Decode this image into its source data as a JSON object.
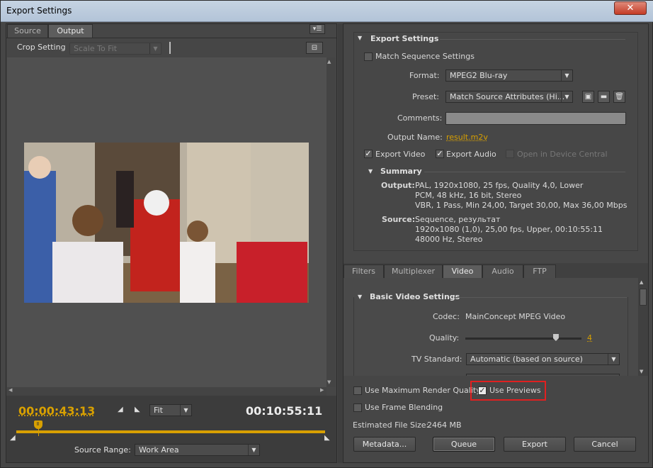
{
  "window": {
    "title": "Export Settings",
    "close_label": "✕"
  },
  "left": {
    "tabs": [
      {
        "label": "Source"
      },
      {
        "label": "Output"
      }
    ],
    "panel_menu_icon": "panel-menu-icon",
    "crop_label": "Crop Setting",
    "crop_value": "Scale To Fit",
    "timecode_current": "00:00:43:13",
    "timecode_total": "00:10:55:11",
    "zoom_value": "Fit",
    "source_range_label": "Source Range:",
    "source_range_value": "Work Area",
    "playhead_fraction": 0.07
  },
  "export": {
    "header": "Export Settings",
    "match_sequence": "Match Sequence Settings",
    "format_label": "Format:",
    "format_value": "MPEG2 Blu-ray",
    "preset_label": "Preset:",
    "preset_value": "Match Source Attributes (Hi...",
    "comments_label": "Comments:",
    "comments_value": "",
    "output_name_label": "Output Name:",
    "output_name_value": "result.m2v",
    "export_video": "Export Video",
    "export_audio": "Export Audio",
    "open_device_central": "Open in Device Central",
    "summary_header": "Summary",
    "output_label": "Output:",
    "output_lines": [
      "PAL, 1920x1080, 25 fps, Quality 4,0, Lower",
      "PCM, 48 kHz, 16 bit, Stereo",
      "VBR, 1 Pass, Min 24,00, Target 30,00, Max 36,00 Mbps"
    ],
    "source_label": "Source:",
    "source_lines": [
      "Sequence, результат",
      "1920x1080 (1,0), 25,00 fps, Upper, 00:10:55:11",
      "48000 Hz, Stereo"
    ]
  },
  "tabs2": [
    {
      "label": "Filters"
    },
    {
      "label": "Multiplexer"
    },
    {
      "label": "Video"
    },
    {
      "label": "Audio"
    },
    {
      "label": "FTP"
    }
  ],
  "video": {
    "header": "Basic Video Settings",
    "codec_label": "Codec:",
    "codec_value": "MainConcept MPEG Video",
    "quality_label": "Quality:",
    "quality_value": "4",
    "quality_fraction": 0.78,
    "tv_label": "TV Standard:",
    "tv_value": "Automatic (based on source)"
  },
  "bottom": {
    "max_render": "Use Maximum Render Quality",
    "use_previews": "Use Previews",
    "frame_blending": "Use Frame Blending",
    "file_size_label": "Estimated File Size:",
    "file_size_value": "2464 MB",
    "metadata": "Metadata...",
    "queue": "Queue",
    "export": "Export",
    "cancel": "Cancel"
  },
  "colors": {
    "accent": "#d8a000",
    "highlight": "#e02020"
  }
}
